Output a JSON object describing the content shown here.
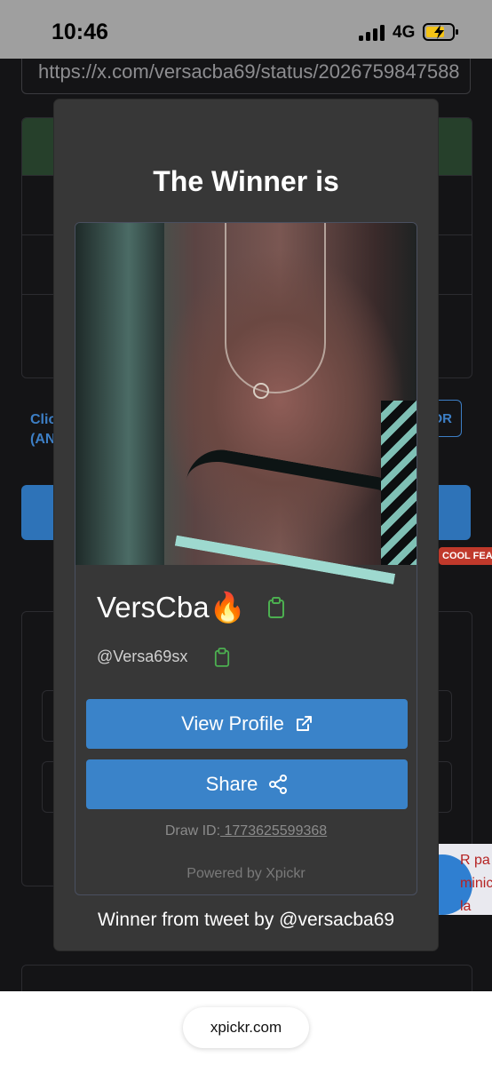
{
  "status_bar": {
    "time": "10:46",
    "network": "4G"
  },
  "background_page": {
    "url": "https://x.com/versacba69/status/2026759847588",
    "side_text_line1": "Clic",
    "side_text_line2": "(AN",
    "outline_button": "OR",
    "badge": "COOL FEA",
    "ad_text_line1": "R pa",
    "ad_text_line2": "minic",
    "ad_text_line3": "la clave d"
  },
  "modal": {
    "title": "The Winner is",
    "winner_display_name": "VersCba🔥",
    "winner_handle": "@Versa69sx",
    "view_profile_label": "View Profile",
    "share_label": "Share",
    "draw_id_label": "Draw ID:",
    "draw_id_value": " 1773625599368",
    "powered_by": "Powered by Xpickr",
    "tweet_source": "Winner from tweet by @versacba69"
  },
  "browser": {
    "domain": "xpickr.com"
  },
  "colors": {
    "primary_button": "#3a83c9",
    "modal_bg": "#373737",
    "copy_icon": "#4caf50"
  }
}
